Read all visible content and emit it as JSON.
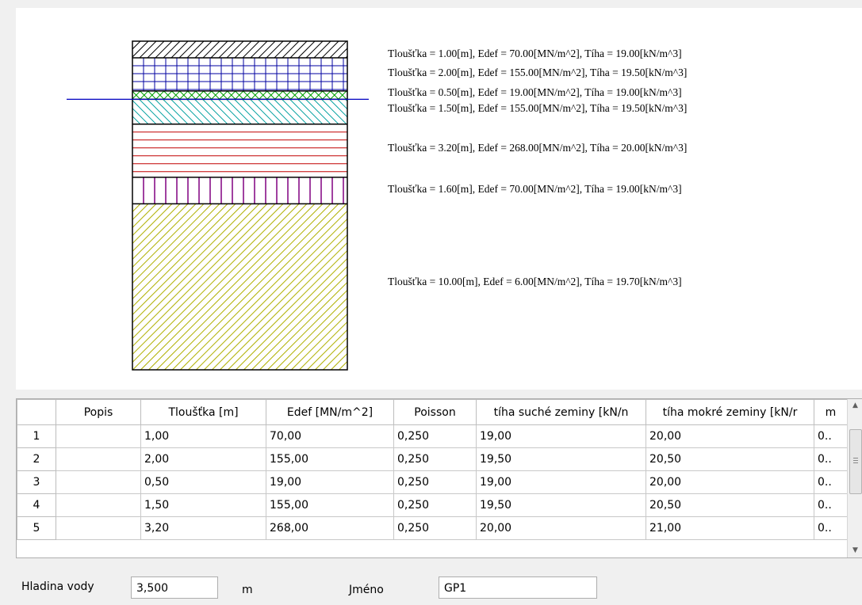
{
  "profile": {
    "layers": [
      {
        "label": "Tloušťka = 1.00[m], Edef = 70.00[MN/m^2], Tíha = 19.00[kN/m^3]",
        "thickness": 1.0,
        "color": "#000000",
        "pattern": "diagonal-hatch"
      },
      {
        "label": "Tloušťka = 2.00[m], Edef = 155.00[MN/m^2], Tíha = 19.50[kN/m^3]",
        "thickness": 2.0,
        "color": "#0000a0",
        "pattern": "grid"
      },
      {
        "label": "Tloušťka = 0.50[m], Edef = 19.00[MN/m^2], Tíha = 19.00[kN/m^3]",
        "thickness": 0.5,
        "color": "#00a000",
        "pattern": "cross-hatch"
      },
      {
        "label": "Tloušťka = 1.50[m], Edef = 155.00[MN/m^2], Tíha = 19.50[kN/m^3]",
        "thickness": 1.5,
        "color": "#00a0a0",
        "pattern": "back-diagonal"
      },
      {
        "label": "Tloušťka = 3.20[m], Edef = 268.00[MN/m^2], Tíha = 20.00[kN/m^3]",
        "thickness": 3.2,
        "color": "#c00000",
        "pattern": "horizontal-lines"
      },
      {
        "label": "Tloušťka = 1.60[m], Edef = 70.00[MN/m^2], Tíha = 19.00[kN/m^3]",
        "thickness": 1.6,
        "color": "#800080",
        "pattern": "vertical-lines"
      },
      {
        "label": "Tloušťka = 10.00[m], Edef = 6.00[MN/m^2], Tíha = 19.70[kN/m^3]",
        "thickness": 10.0,
        "color": "#b0b000",
        "pattern": "diagonal-hatch"
      }
    ],
    "water_level": 3.5,
    "water_color": "#0000c0"
  },
  "table": {
    "columns": [
      "",
      "Popis",
      "Tloušťka [m]",
      "Edef [MN/m^2]",
      "Poisson",
      "tíha suché zeminy [kN/n",
      "tíha mokré zeminy [kN/r",
      "m"
    ],
    "rows": [
      [
        "1",
        "",
        "1,00",
        "70,00",
        "0,250",
        "19,00",
        "20,00",
        "0.."
      ],
      [
        "2",
        "",
        "2,00",
        "155,00",
        "0,250",
        "19,50",
        "20,50",
        "0.."
      ],
      [
        "3",
        "",
        "0,50",
        "19,00",
        "0,250",
        "19,00",
        "20,00",
        "0.."
      ],
      [
        "4",
        "",
        "1,50",
        "155,00",
        "0,250",
        "19,50",
        "20,50",
        "0.."
      ],
      [
        "5",
        "",
        "3,20",
        "268,00",
        "0,250",
        "20,00",
        "21,00",
        "0.."
      ]
    ]
  },
  "form": {
    "water_label": "Hladina vody",
    "water_value": "3,500",
    "water_unit": "m",
    "name_label": "Jméno",
    "name_value": "GP1"
  }
}
